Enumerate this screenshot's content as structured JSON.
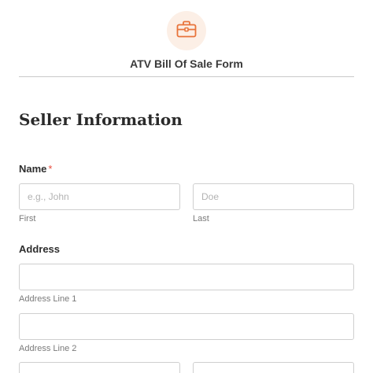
{
  "header": {
    "icon": "briefcase-icon",
    "accent_color": "#e8733a",
    "title": "ATV Bill Of Sale Form"
  },
  "section": {
    "title": "Seller Information"
  },
  "name_field": {
    "label": "Name",
    "required_marker": "*",
    "first": {
      "placeholder": "e.g., John",
      "value": "",
      "sublabel": "First"
    },
    "last": {
      "placeholder": "Doe",
      "value": "",
      "sublabel": "Last"
    }
  },
  "address_field": {
    "label": "Address",
    "line1": {
      "value": "",
      "sublabel": "Address Line 1"
    },
    "line2": {
      "value": "",
      "sublabel": "Address Line 2"
    }
  }
}
